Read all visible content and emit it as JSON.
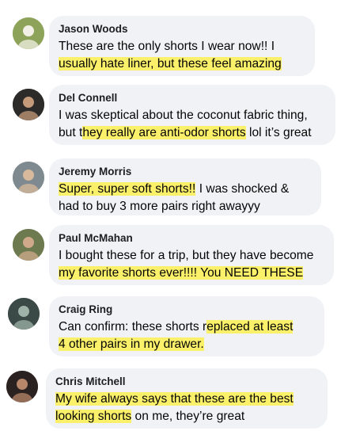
{
  "comments": [
    {
      "name": "Jason Woods",
      "lines": [
        [
          {
            "t": "These are the only shorts I wear now!! I",
            "hl": false
          }
        ],
        [
          {
            "t": "usually hate liner, but these feel amazing",
            "hl": true
          }
        ]
      ],
      "avatar": {
        "bg": "#8da35a",
        "fg": "#f2f0e6",
        "motif": "outdoor-portrait"
      }
    },
    {
      "name": "Del Connell",
      "lines": [
        [
          {
            "t": "I was skeptical about the coconut fabric thing,",
            "hl": false
          }
        ],
        [
          {
            "t": "but t",
            "hl": false
          },
          {
            "t": "hey really are anti-odor shorts",
            "hl": true
          },
          {
            "t": " lol it’s great",
            "hl": false
          }
        ]
      ],
      "avatar": {
        "bg": "#2c2b2a",
        "fg": "#c49a7a",
        "motif": "bearded-portrait"
      }
    },
    {
      "name": "Jeremy Morris",
      "lines": [
        [
          {
            "t": "Super, super soft shorts!!",
            "hl": true
          },
          {
            "t": " I was shocked &",
            "hl": false
          }
        ],
        [
          {
            "t": "had to buy 3 more pairs right awayyy",
            "hl": false
          }
        ]
      ],
      "avatar": {
        "bg": "#7e8a8f",
        "fg": "#d9b99b",
        "motif": "cap-portrait"
      }
    },
    {
      "name": "Paul McMahan",
      "lines": [
        [
          {
            "t": "I bought these for a trip, but they have become",
            "hl": false
          }
        ],
        [
          {
            "t": "my favorite shorts ever!!!! You NEED THESE",
            "hl": true
          }
        ]
      ],
      "avatar": {
        "bg": "#6d7a4f",
        "fg": "#cfa98a",
        "motif": "outdoor-group"
      }
    },
    {
      "name": "Craig Ring",
      "lines": [
        [
          {
            "t": "Can confirm: these shorts r",
            "hl": false
          },
          {
            "t": "eplaced at least",
            "hl": true
          }
        ],
        [
          {
            "t": "4 other pairs in my drawer.",
            "hl": true
          }
        ]
      ],
      "avatar": {
        "bg": "#3b4a46",
        "fg": "#9fb3a8",
        "motif": "dark-portrait"
      }
    },
    {
      "name": "Chris Mitchell",
      "lines": [
        [
          {
            "t": "My wife always says that these are the best",
            "hl": true
          }
        ],
        [
          {
            "t": "looking shorts",
            "hl": true
          },
          {
            "t": " on me, they’re great",
            "hl": false
          }
        ]
      ],
      "avatar": {
        "bg": "#2a2220",
        "fg": "#b8876a",
        "motif": "bald-portrait"
      }
    }
  ],
  "colors": {
    "bubble": "#f0f2f5",
    "highlight": "#fbf06a",
    "name_text": "#1c1e21",
    "body_text": "#050505"
  }
}
